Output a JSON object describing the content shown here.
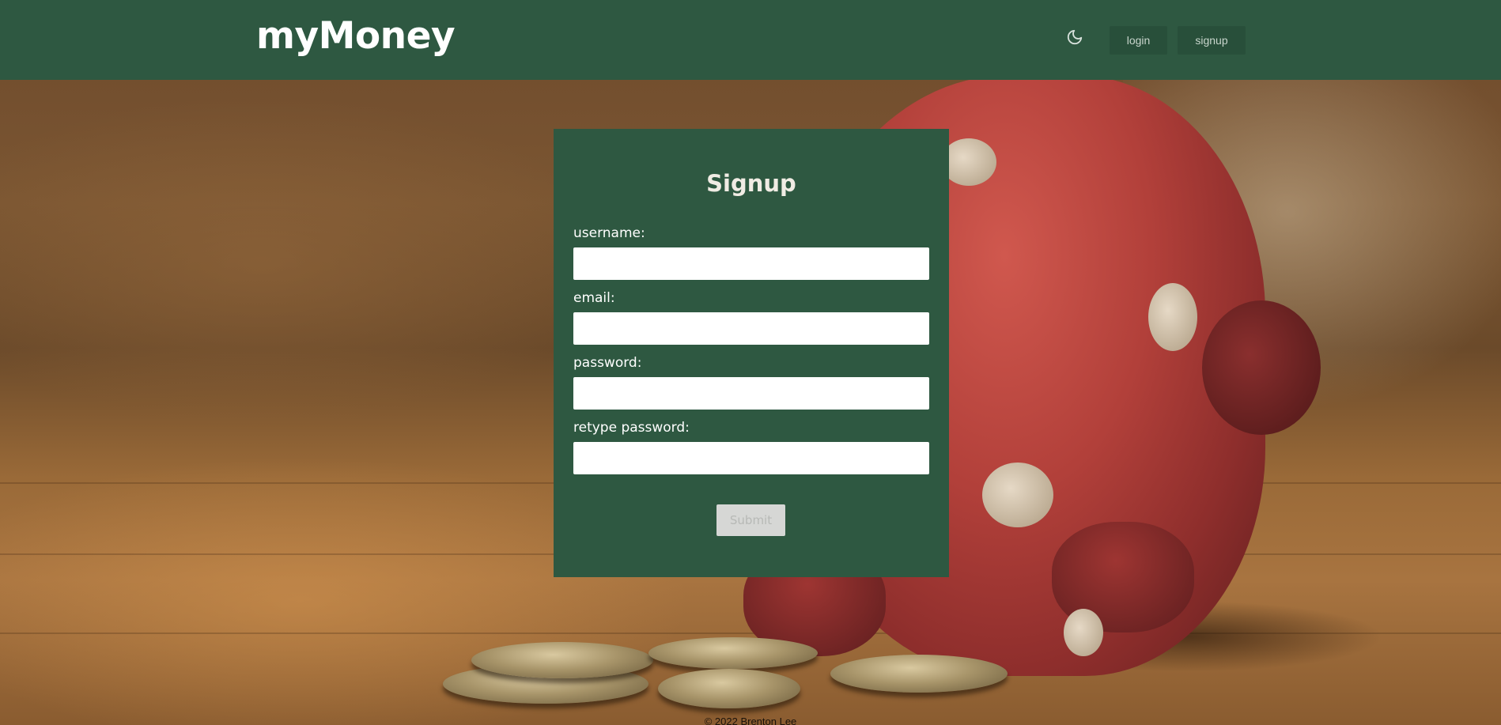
{
  "app": {
    "title": "myMoney"
  },
  "header": {
    "theme_toggle_icon": "moon-icon",
    "login_label": "login",
    "signup_label": "signup"
  },
  "signup_form": {
    "title": "Signup",
    "fields": [
      {
        "label": "username:",
        "value": "",
        "placeholder": ""
      },
      {
        "label": "email:",
        "value": "",
        "placeholder": ""
      },
      {
        "label": "password:",
        "value": "",
        "placeholder": ""
      },
      {
        "label": "retype password:",
        "value": "",
        "placeholder": ""
      }
    ],
    "submit_label": "Submit"
  },
  "footer": {
    "text": "© 2022 Brenton Lee"
  },
  "colors": {
    "header_bg": "#2e5841",
    "card_bg": "#2e5841",
    "nav_button_bg": "#284f3a",
    "submit_bg": "#d6d7d5"
  }
}
